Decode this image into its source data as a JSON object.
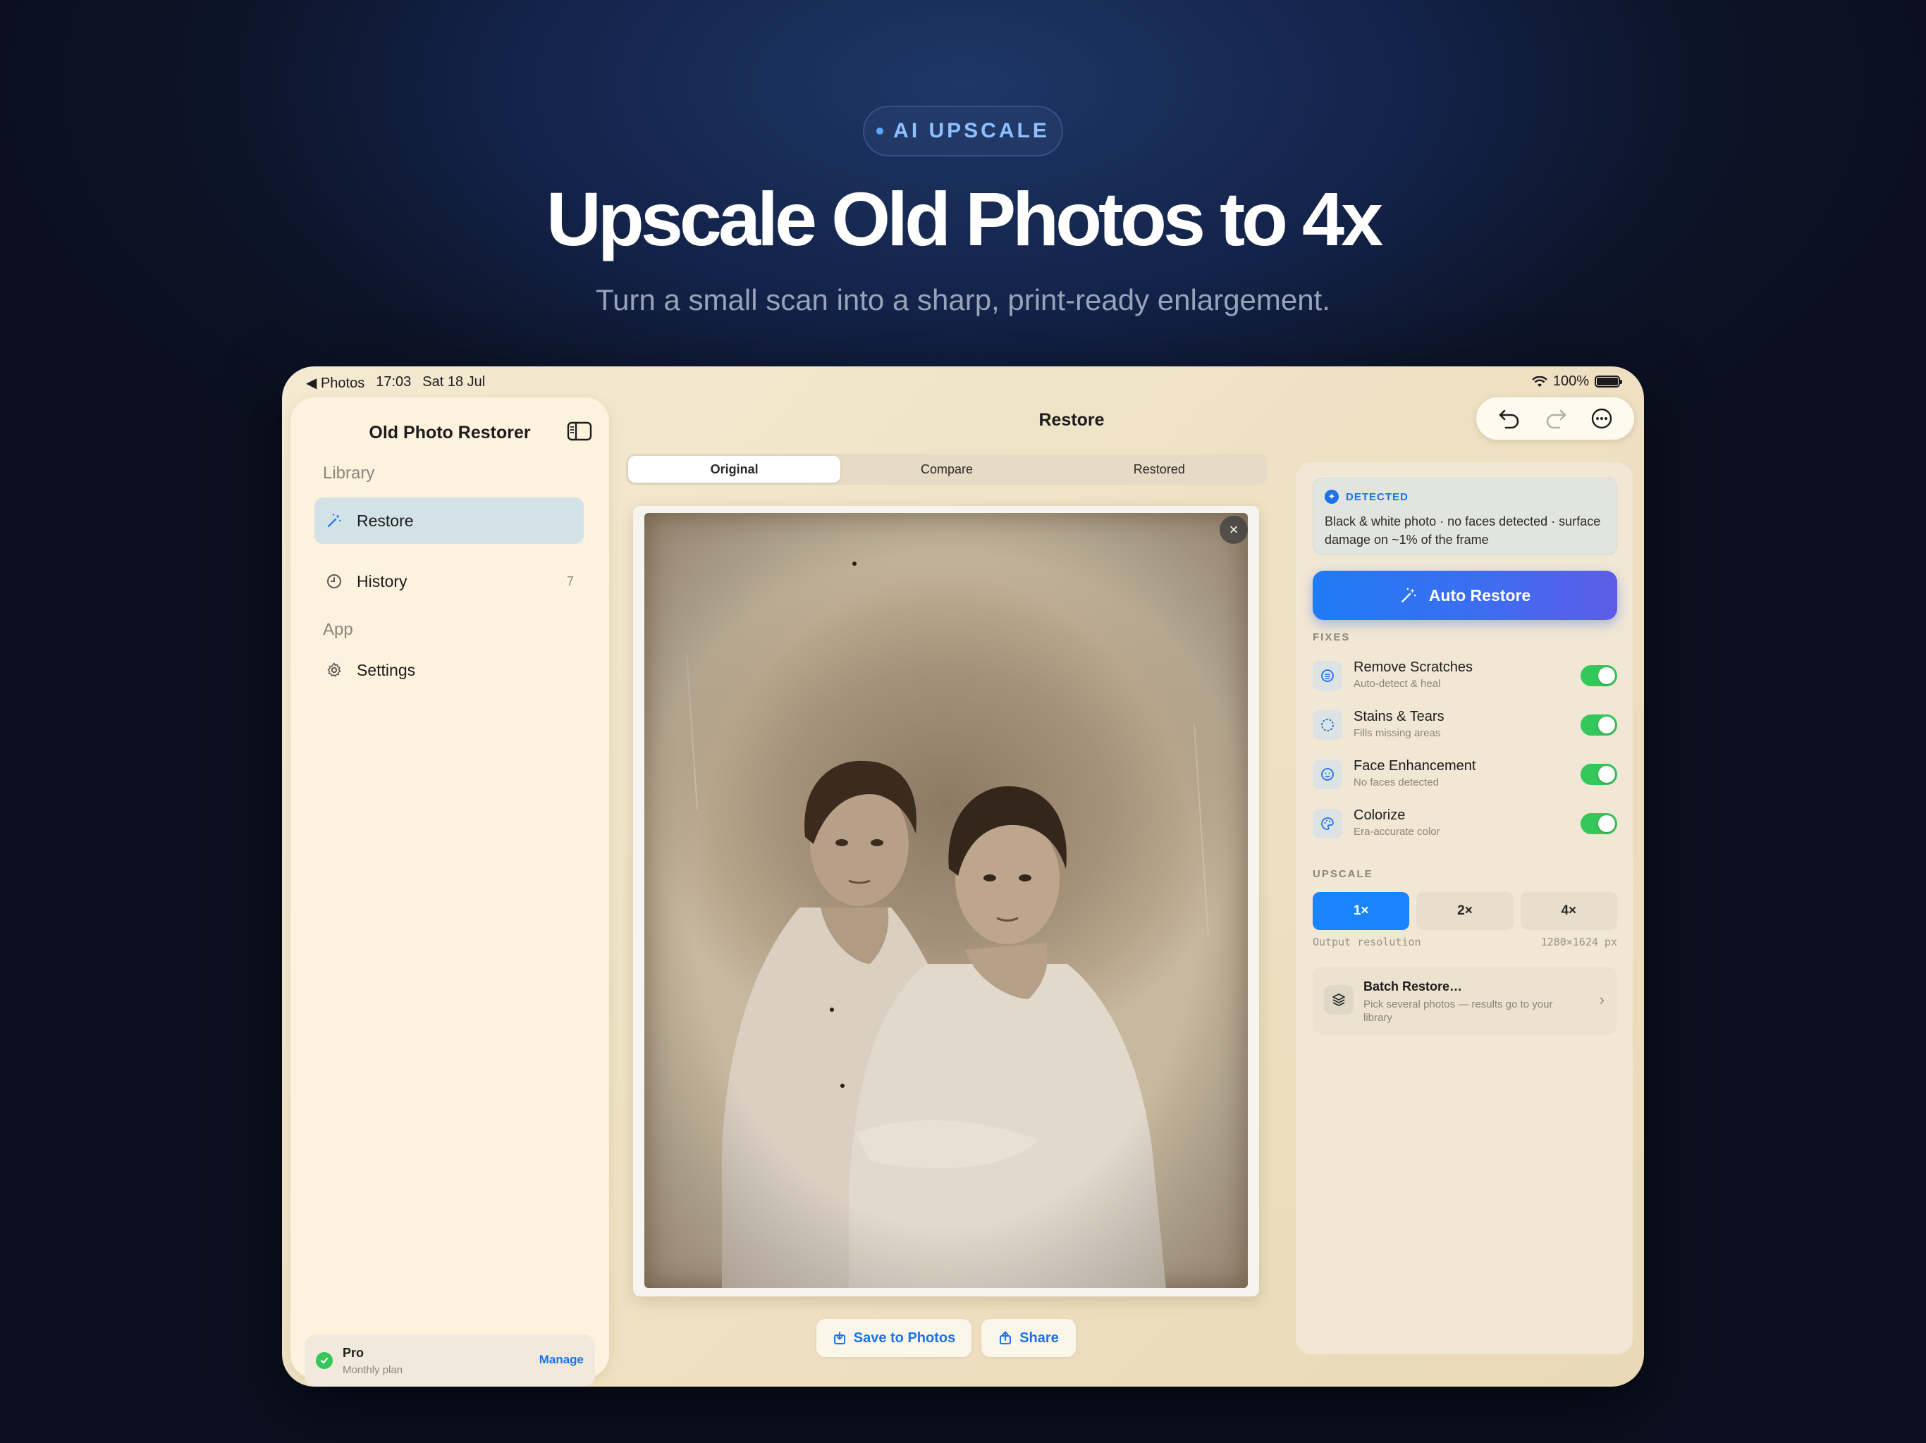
{
  "hero": {
    "badge": "AI UPSCALE",
    "title": "Upscale Old Photos to 4x",
    "subtitle": "Turn a small scan into a sharp, print-ready enlargement."
  },
  "statusbar": {
    "back_app": "◀ Photos",
    "time": "17:03",
    "date": "Sat 18 Jul",
    "battery": "100%"
  },
  "sidebar": {
    "title": "Old Photo Restorer",
    "library_label": "Library",
    "app_label": "App",
    "items": [
      {
        "label": "Restore",
        "icon": "magic-wand-icon",
        "active": true
      },
      {
        "label": "History",
        "icon": "clock-icon",
        "count": "7"
      },
      {
        "label": "Settings",
        "icon": "gear-icon"
      }
    ],
    "plan": {
      "title": "Pro",
      "subtitle": "Monthly plan",
      "action": "Manage"
    }
  },
  "main": {
    "title": "Restore",
    "tabs": [
      "Original",
      "Compare",
      "Restored"
    ],
    "active_tab": "Original",
    "save_label": "Save to Photos",
    "share_label": "Share"
  },
  "panel": {
    "detected_label": "DETECTED",
    "detected_text": "Black & white photo · no faces detected · surface damage on ~1% of the frame",
    "auto_restore": "Auto Restore",
    "fixes_label": "FIXES",
    "fixes": [
      {
        "title": "Remove Scratches",
        "subtitle": "Auto-detect & heal",
        "icon": "scratch-icon",
        "on": true
      },
      {
        "title": "Stains & Tears",
        "subtitle": "Fills missing areas",
        "icon": "circle-icon",
        "on": true
      },
      {
        "title": "Face Enhancement",
        "subtitle": "No faces detected",
        "icon": "face-icon",
        "on": true
      },
      {
        "title": "Colorize",
        "subtitle": "Era-accurate color",
        "icon": "palette-icon",
        "on": true
      }
    ],
    "upscale_label": "UPSCALE",
    "upscale_options": [
      "1×",
      "2×",
      "4×"
    ],
    "upscale_selected": "1×",
    "output_label": "Output resolution",
    "output_value": "1280×1624 px",
    "batch_title": "Batch Restore…",
    "batch_subtitle": "Pick several photos — results go to your library"
  },
  "colors": {
    "accent": "#1a73e8",
    "toggle_on": "#34c759",
    "sidebar_bg": "#fdf2de",
    "active_nav": "#d3e2e6"
  }
}
